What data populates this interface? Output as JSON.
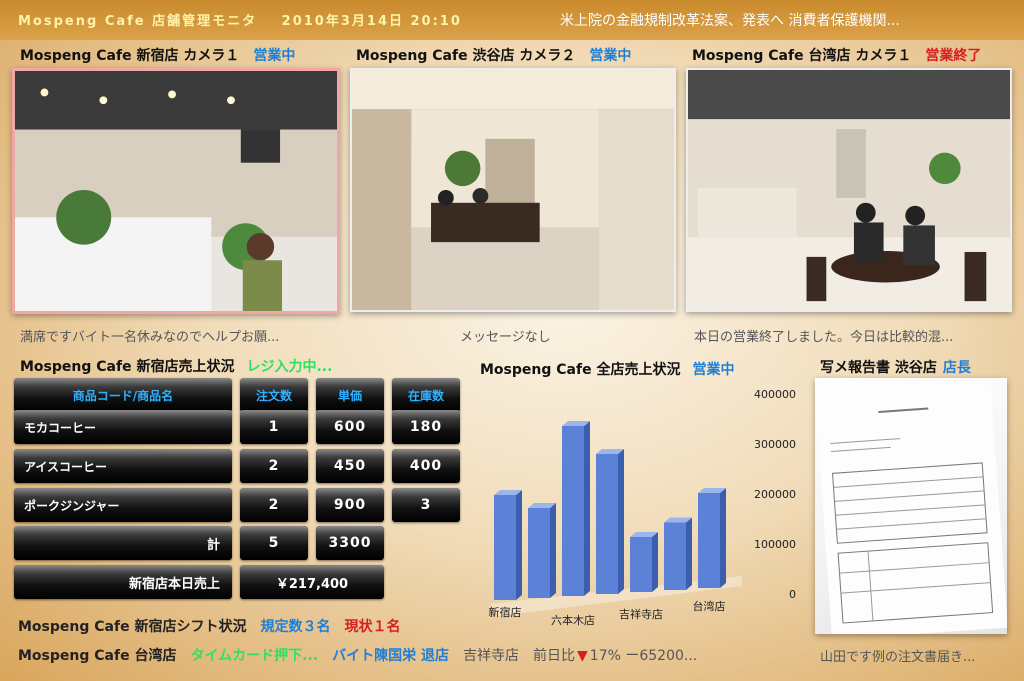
{
  "header": {
    "brand": "Mospeng Cafe 店舗管理モニタ",
    "datetime": "2010年3月14日 20:10",
    "ticker": "米上院の金融規制改革法案、発表へ 消費者保護機関..."
  },
  "cameras": [
    {
      "title": "Mospeng Cafe 新宿店 カメラ１",
      "status": "営業中",
      "message": "満席ですバイト一名休みなのでヘルプお願..."
    },
    {
      "title": "Mospeng Cafe 渋谷店 カメラ２",
      "status": "営業中",
      "message": "メッセージなし"
    },
    {
      "title": "Mospeng Cafe 台湾店 カメラ１",
      "status": "営業終了",
      "message": "本日の営業終了しました。今日は比較的混..."
    }
  ],
  "sales_table": {
    "title": "Mospeng Cafe 新宿店売上状況",
    "status": "レジ入力中...",
    "headers": [
      "商品コード/商品名",
      "注文数",
      "単価",
      "在庫数"
    ],
    "rows": [
      [
        "モカコーヒー",
        "1",
        "600",
        "180"
      ],
      [
        "アイスコーヒー",
        "2",
        "450",
        "400"
      ],
      [
        "ポークジンジャー",
        "2",
        "900",
        "3"
      ]
    ],
    "total_label": "計",
    "total_qty": "5",
    "total_amount": "3300",
    "daily_label": "新宿店本日売上",
    "daily_value": "￥217,400"
  },
  "all_sales": {
    "title": "Mospeng Cafe 全店売上状況",
    "status": "営業中"
  },
  "chart_data": {
    "type": "bar",
    "categories": [
      "新宿店",
      "",
      "六本木店",
      "",
      "吉祥寺店",
      "",
      "台湾店"
    ],
    "values": [
      210000,
      180000,
      340000,
      280000,
      110000,
      135000,
      190000
    ],
    "ticks": [
      "400000",
      "300000",
      "200000",
      "100000",
      "0"
    ],
    "ylim": [
      0,
      400000
    ],
    "bar_color": "#5b82d6"
  },
  "report": {
    "title": "写メ報告書 渋谷店",
    "role": "店長",
    "caption": "山田です例の注文書届き..."
  },
  "shift": {
    "title": "Mospeng Cafe 新宿店シフト状況",
    "required": "規定数３名",
    "current": "現状１名"
  },
  "bottom_ticker": {
    "store": "Mospeng Cafe 台湾店",
    "event1": "タイムカード押下...",
    "event2": "バイト陳国栄 退店",
    "store2": "吉祥寺店",
    "compare_label": "前日比",
    "arrow": "▼",
    "compare_value": "17% ー65200..."
  }
}
